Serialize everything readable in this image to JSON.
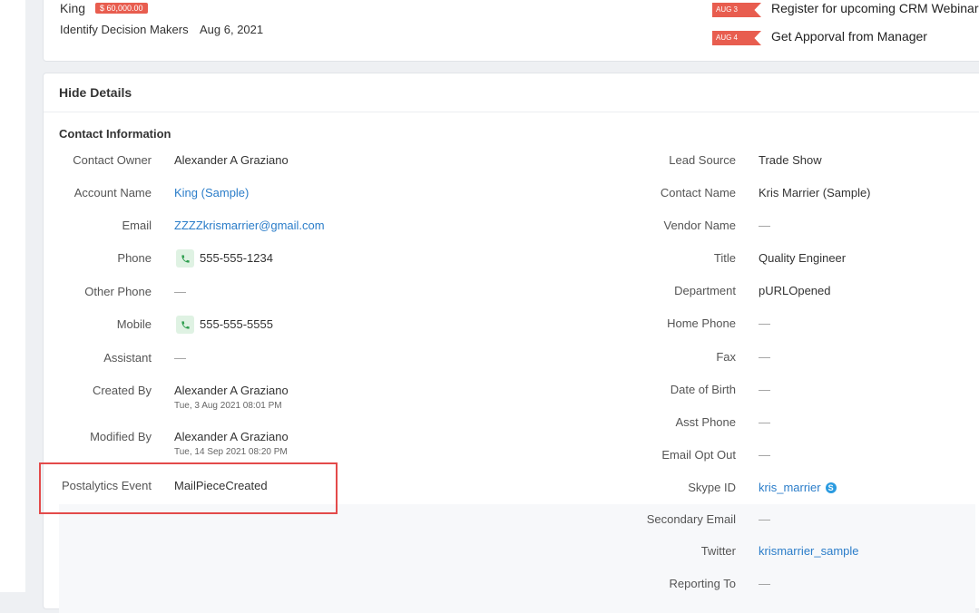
{
  "deal": {
    "name": "King",
    "amount": "$ 60,000.00",
    "stage": "Identify Decision Makers",
    "date": "Aug 6, 2021"
  },
  "tasks": [
    {
      "date_tag": "AUG 3",
      "text": "Register for upcoming CRM Webinars"
    },
    {
      "date_tag": "AUG 4",
      "text": "Get Apporval from Manager"
    }
  ],
  "details": {
    "toggle_label": "Hide Details",
    "section_title": "Contact Information"
  },
  "left_fields": [
    {
      "label": "Contact Owner",
      "value": "Alexander A Graziano"
    },
    {
      "label": "Account Name",
      "value": "King (Sample)"
    },
    {
      "label": "Email",
      "value": "ZZZZkrismarrier@gmail.com"
    },
    {
      "label": "Phone",
      "value": "555-555-1234"
    },
    {
      "label": "Other Phone",
      "value": "—"
    },
    {
      "label": "Mobile",
      "value": "555-555-5555"
    },
    {
      "label": "Assistant",
      "value": "—"
    },
    {
      "label": "Created By",
      "value": "Alexander A Graziano",
      "sub": "Tue, 3 Aug 2021 08:01 PM"
    },
    {
      "label": "Modified By",
      "value": "Alexander A Graziano",
      "sub": "Tue, 14 Sep 2021 08:20 PM"
    },
    {
      "label": "Postalytics Event",
      "value": "MailPieceCreated"
    }
  ],
  "right_fields": [
    {
      "label": "Lead Source",
      "value": "Trade Show"
    },
    {
      "label": "Contact Name",
      "value": "Kris Marrier (Sample)"
    },
    {
      "label": "Vendor Name",
      "value": "—"
    },
    {
      "label": "Title",
      "value": "Quality Engineer"
    },
    {
      "label": "Department",
      "value": "pURLOpened"
    },
    {
      "label": "Home Phone",
      "value": "—"
    },
    {
      "label": "Fax",
      "value": "—"
    },
    {
      "label": "Date of Birth",
      "value": "—"
    },
    {
      "label": "Asst Phone",
      "value": "—"
    },
    {
      "label": "Email Opt Out",
      "value": "—"
    },
    {
      "label": "Skype ID",
      "value": "kris_marrier"
    },
    {
      "label": "Secondary Email",
      "value": "—"
    },
    {
      "label": "Twitter",
      "value": "krismarrier_sample"
    },
    {
      "label": "Reporting To",
      "value": "—"
    }
  ],
  "icons": {
    "phone": "phone-icon",
    "skype": "skype-icon"
  },
  "colors": {
    "link": "#2b7dc9",
    "badge": "#e85d4f",
    "highlight": "#e34a4a",
    "phone_bg": "#dff2e3"
  }
}
